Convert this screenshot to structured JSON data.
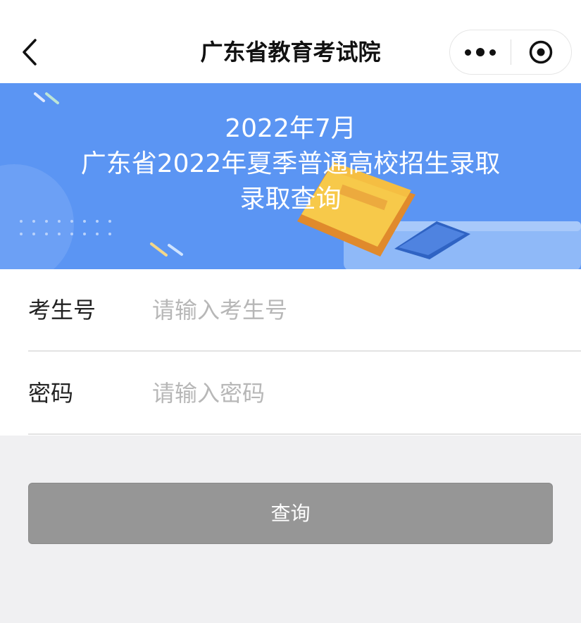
{
  "navbar": {
    "title": "广东省教育考试院",
    "back_icon": "chevron-left-icon",
    "more_icon": "more-dots-icon",
    "close_icon": "target-circle-icon"
  },
  "banner": {
    "line1": "2022年7月",
    "line2": "广东省2022年夏季普通高校招生录取",
    "line3": "录取查询",
    "background_color": "#5b95f3"
  },
  "form": {
    "exam_number": {
      "label": "考生号",
      "placeholder": "请输入考生号",
      "value": ""
    },
    "password": {
      "label": "密码",
      "placeholder": "请输入密码",
      "value": ""
    }
  },
  "actions": {
    "query_label": "查询",
    "query_button_color": "#969696"
  }
}
